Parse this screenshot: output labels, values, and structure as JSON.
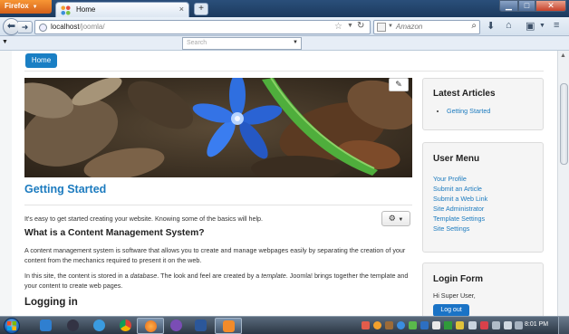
{
  "browser": {
    "app_menu_label": "Firefox",
    "tab_title": "Home",
    "new_tab_label": "+",
    "url_host": "localhost",
    "url_path": "/joomla/",
    "search_engine": "Amazon"
  },
  "bookmarks": {
    "search_placeholder": "Search"
  },
  "site": {
    "nav_home": "Home",
    "article": {
      "title": "Getting Started",
      "intro": "It's easy to get started creating your website. Knowing some of the basics will help.",
      "h2_cms": "What is a Content Management System?",
      "p_cms": "A content management system is software that allows you to create and manage webpages easily by separating the creation of your content from the mechanics required to present it on the web.",
      "p_site_1": "In this site, the content is stored in a ",
      "p_site_db": "database",
      "p_site_2": ". The look and feel are created by a ",
      "p_site_tpl": "template",
      "p_site_3": ". Joomla! brings together the template and your content to create web pages.",
      "h2_login": "Logging in"
    },
    "latest_articles": {
      "title": "Latest Articles",
      "items": [
        "Getting Started"
      ]
    },
    "user_menu": {
      "title": "User Menu",
      "items": [
        "Your Profile",
        "Submit an Article",
        "Submit a Web Link",
        "Site Administrator",
        "Template Settings",
        "Site Settings"
      ]
    },
    "login_form": {
      "title": "Login Form",
      "greeting": "Hi Super User,",
      "logout_label": "Log out"
    }
  },
  "taskbar": {
    "clock": "8:01 PM"
  },
  "colors": {
    "link_blue": "#1c7bbf",
    "button_blue": "#1a73c6",
    "firefox_orange": "#e67325"
  }
}
